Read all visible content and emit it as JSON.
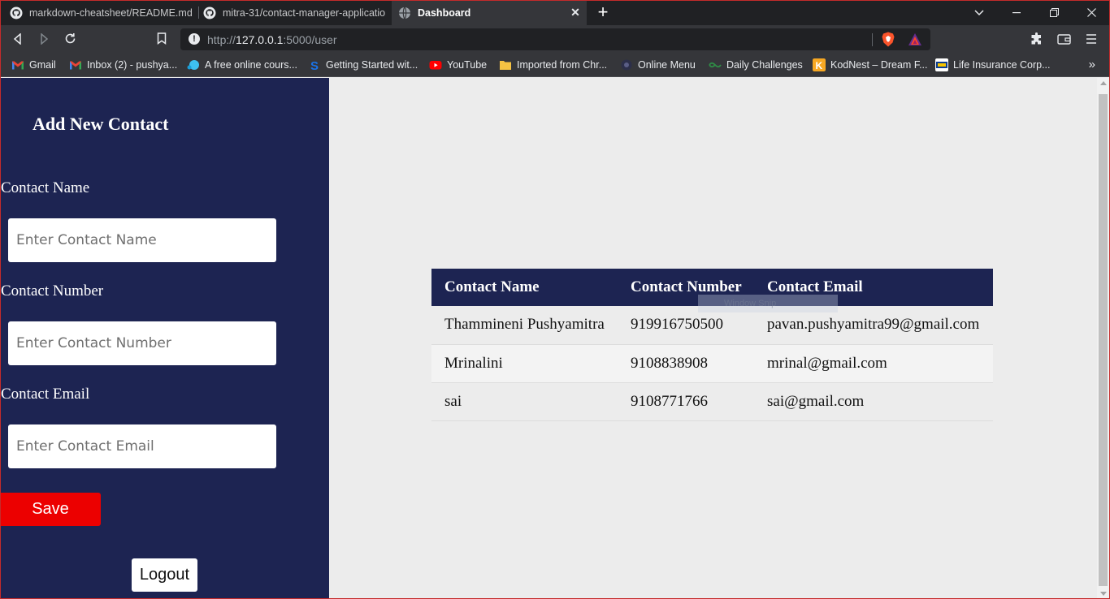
{
  "browser": {
    "tabs": [
      {
        "title": "markdown-cheatsheet/README.md at",
        "icon": "github-icon",
        "active": false
      },
      {
        "title": "mitra-31/contact-manager-applicatio",
        "icon": "github-icon",
        "active": false
      },
      {
        "title": "Dashboard",
        "icon": "globe-icon",
        "active": true
      }
    ],
    "new_tab": "+",
    "url": {
      "scheme": "http://",
      "host": "127.0.0.1",
      "path": ":5000/user"
    },
    "bookmarks": [
      {
        "label": "Gmail",
        "icon": "gmail-icon"
      },
      {
        "label": "Inbox (2) - pushya...",
        "icon": "gmail-icon"
      },
      {
        "label": "A free online cours...",
        "icon": "course-icon"
      },
      {
        "label": "Getting Started wit...",
        "icon": "s-logo-icon"
      },
      {
        "label": "YouTube",
        "icon": "youtube-icon"
      },
      {
        "label": "Imported from Chr...",
        "icon": "folder-icon"
      },
      {
        "label": "Online Menu",
        "icon": "menu-icon"
      },
      {
        "label": "Daily Challenges",
        "icon": "challenge-icon"
      },
      {
        "label": "KodNest – Dream F...",
        "icon": "kodnest-icon"
      },
      {
        "label": "Life Insurance Corp...",
        "icon": "lic-icon"
      }
    ],
    "colors": {
      "tab_strip": "#202124",
      "toolbar": "#35363a",
      "frame": "#c42b2b"
    }
  },
  "sidebar": {
    "title": "Add New Contact",
    "name_label": "Contact Name",
    "name_placeholder": "Enter Contact Name",
    "number_label": "Contact Number",
    "number_placeholder": "Enter Contact Number",
    "email_label": "Contact Email",
    "email_placeholder": "Enter Contact Email",
    "save_label": "Save",
    "logout_label": "Logout",
    "colors": {
      "background": "#1d2452",
      "save_button": "#ec0000"
    }
  },
  "table": {
    "headers": [
      "Contact Name",
      "Contact Number",
      "Contact Email"
    ],
    "rows": [
      [
        "Thammineni Pushyamitra",
        "919916750500",
        "pavan.pushyamitra99@gmail.com"
      ],
      [
        "Mrinalini",
        "9108838908",
        "mrinal@gmail.com"
      ],
      [
        "sai",
        "9108771766",
        "sai@gmail.com"
      ]
    ],
    "ghost_text": "Window Snip"
  }
}
